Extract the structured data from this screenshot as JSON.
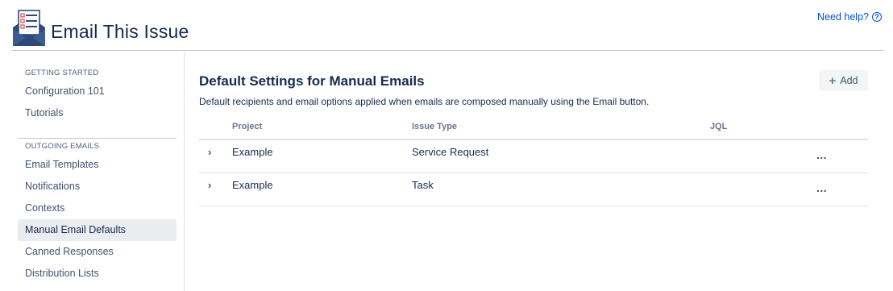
{
  "header": {
    "app_title": "Email This Issue",
    "help_label": "Need help?",
    "help_icon": "?"
  },
  "sidebar": {
    "sections": [
      {
        "heading": "GETTING STARTED",
        "items": [
          {
            "label": "Configuration 101"
          },
          {
            "label": "Tutorials"
          }
        ]
      },
      {
        "heading": "OUTGOING EMAILS",
        "items": [
          {
            "label": "Email Templates"
          },
          {
            "label": "Notifications"
          },
          {
            "label": "Contexts"
          },
          {
            "label": "Manual Email Defaults",
            "active": true
          },
          {
            "label": "Canned Responses"
          },
          {
            "label": "Distribution Lists"
          }
        ]
      }
    ]
  },
  "main": {
    "title": "Default Settings for Manual Emails",
    "description": "Default recipients and email options applied when emails are composed manually using the Email button.",
    "add_button": {
      "icon": "+",
      "label": "Add"
    },
    "table": {
      "columns": [
        "Project",
        "Issue Type",
        "JQL"
      ],
      "rows": [
        {
          "expand_icon": "›",
          "project": "Example",
          "issue_type": "Service Request",
          "jql": "",
          "more_icon": "..."
        },
        {
          "expand_icon": "›",
          "project": "Example",
          "issue_type": "Task",
          "jql": "",
          "more_icon": "..."
        }
      ]
    }
  },
  "colors": {
    "accent": "#0052cc",
    "text": "#172b4d",
    "active_nav_bg": "#ebecf0",
    "logo_navy": "#2f4a7a"
  }
}
